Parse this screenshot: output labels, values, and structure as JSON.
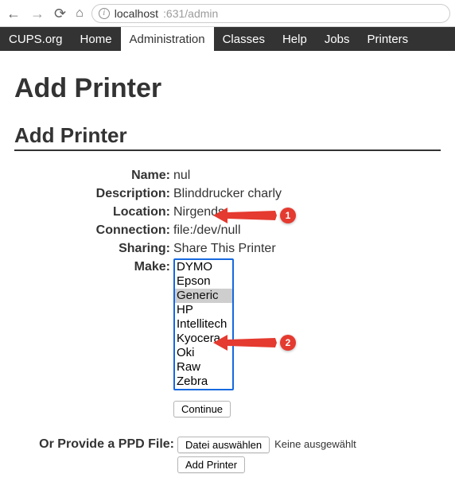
{
  "browser": {
    "url_host": "localhost",
    "url_port_path": ":631/admin"
  },
  "nav": {
    "items": [
      {
        "label": "CUPS.org"
      },
      {
        "label": "Home"
      },
      {
        "label": "Administration"
      },
      {
        "label": "Classes"
      },
      {
        "label": "Help"
      },
      {
        "label": "Jobs"
      },
      {
        "label": "Printers"
      }
    ],
    "active_index": 2
  },
  "page": {
    "h1": "Add Printer",
    "h2": "Add Printer"
  },
  "printer": {
    "labels": {
      "name": "Name:",
      "description": "Description:",
      "location": "Location:",
      "connection": "Connection:",
      "sharing": "Sharing:",
      "make": "Make:"
    },
    "name": "nul",
    "description": "Blinddrucker charly",
    "location": "Nirgends",
    "connection": "file:/dev/null",
    "sharing": "Share This Printer",
    "makes": [
      "DYMO",
      "Epson",
      "Generic",
      "HP",
      "Intellitech",
      "Kyocera",
      "Oki",
      "Raw",
      "Zebra"
    ],
    "selected_make_index": 2,
    "continue_label": "Continue"
  },
  "ppd": {
    "label": "Or Provide a PPD File:",
    "choose_label": "Datei auswählen",
    "none_chosen": "Keine ausgewählt",
    "add_label": "Add Printer"
  },
  "callouts": {
    "c1": "1",
    "c2": "2"
  }
}
